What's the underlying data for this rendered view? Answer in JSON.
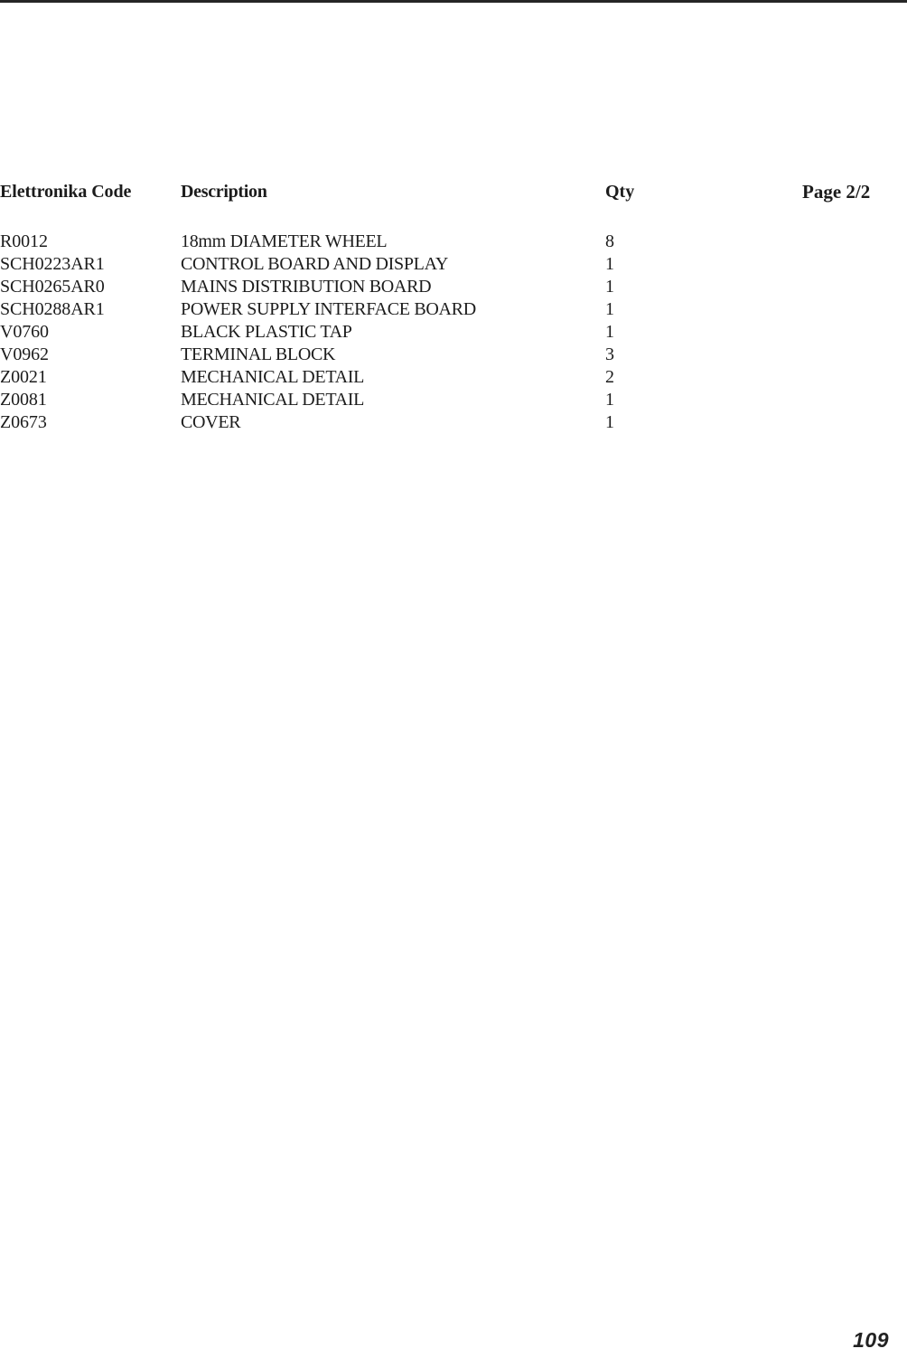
{
  "document": {
    "page_number": "109"
  },
  "table": {
    "headers": {
      "code": "Elettronika Code",
      "description": "Description",
      "qty": "Qty",
      "page": "Page 2/2"
    },
    "rows": [
      {
        "code": "R0012",
        "description": "18mm DIAMETER WHEEL",
        "qty": "8"
      },
      {
        "code": "SCH0223AR1",
        "description": "CONTROL BOARD AND DISPLAY",
        "qty": "1"
      },
      {
        "code": "SCH0265AR0",
        "description": "MAINS DISTRIBUTION BOARD",
        "qty": "1"
      },
      {
        "code": "SCH0288AR1",
        "description": "POWER SUPPLY INTERFACE BOARD",
        "qty": "1"
      },
      {
        "code": "V0760",
        "description": "BLACK PLASTIC TAP",
        "qty": "1"
      },
      {
        "code": "V0962",
        "description": "TERMINAL BLOCK",
        "qty": "3"
      },
      {
        "code": "Z0021",
        "description": "MECHANICAL DETAIL",
        "qty": "2"
      },
      {
        "code": "Z0081",
        "description": "MECHANICAL DETAIL",
        "qty": "1"
      },
      {
        "code": "Z0673",
        "description": "COVER",
        "qty": "1"
      }
    ]
  }
}
